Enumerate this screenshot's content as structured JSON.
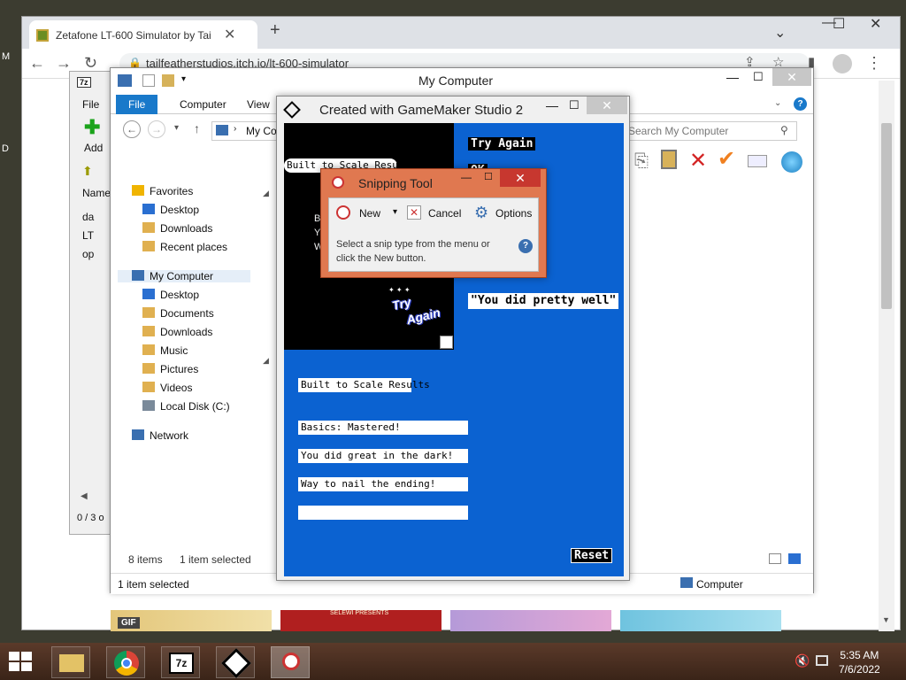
{
  "desktop": {
    "label_m": "M",
    "label_d": "D"
  },
  "chrome": {
    "tab_title": "Zetafone LT-600 Simulator by Tai",
    "tab_close": "✕",
    "new_tab": "+",
    "url": "tailfeatherstudios.itch.io/lt-600-simulator",
    "gif_badge": "GIF",
    "thumb2_text": "SELEWI PRESENTS"
  },
  "explorer": {
    "title": "My Computer",
    "ribbon_tabs": [
      "File",
      "Computer",
      "View"
    ],
    "address": "My Co",
    "search_placeholder": "Search My Computer",
    "nav": [
      {
        "label": "Favorites",
        "level": 0,
        "color": "#f0b400"
      },
      {
        "label": "Desktop",
        "level": 1,
        "color": "#2a6fd1"
      },
      {
        "label": "Downloads",
        "level": 1,
        "color": "#e0b050"
      },
      {
        "label": "Recent places",
        "level": 1,
        "color": "#e0b050"
      },
      {
        "label": "My Computer",
        "level": 0,
        "color": "#3a6fb0"
      },
      {
        "label": "Desktop",
        "level": 1,
        "color": "#2a6fd1"
      },
      {
        "label": "Documents",
        "level": 1,
        "color": "#e0b050"
      },
      {
        "label": "Downloads",
        "level": 1,
        "color": "#e0b050"
      },
      {
        "label": "Music",
        "level": 1,
        "color": "#e0b050"
      },
      {
        "label": "Pictures",
        "level": 1,
        "color": "#e0b050"
      },
      {
        "label": "Videos",
        "level": 1,
        "color": "#e0b050"
      },
      {
        "label": "Local Disk (C:)",
        "level": 1,
        "color": "#7a8a9a"
      },
      {
        "label": "Network",
        "level": 0,
        "color": "#3a6fb0"
      }
    ],
    "items_count": "8 items",
    "selected": "1 item selected",
    "status": "1 item selected",
    "location": "Computer"
  },
  "sevenzip": {
    "file_menu": "File",
    "add_label": "Add",
    "col_name": "Name",
    "files": [
      "da",
      "LT",
      "op"
    ],
    "status": "0 / 3 o"
  },
  "gms": {
    "title": "Created with GameMaker Studio 2",
    "try_again": "Try Again",
    "ok_partial": "OK",
    "black_box_label": "Built to Scale Results",
    "hidden_lines": [
      "Be",
      "Ya",
      "W"
    ],
    "comment": "\"You did pretty well\"",
    "results": [
      "Built to Scale Results",
      "Basics: Mastered!",
      "You did great in the dark!",
      "Way to nail the ending!",
      ""
    ],
    "reset": "Reset",
    "logo_line1": "Try",
    "logo_line2": "Again"
  },
  "snipping": {
    "title": "Snipping Tool",
    "new": "New",
    "cancel": "Cancel",
    "options": "Options",
    "help": "Select a snip type from the menu or click the New button."
  },
  "taskbar": {
    "time": "5:35 AM",
    "date": "7/6/2022"
  }
}
